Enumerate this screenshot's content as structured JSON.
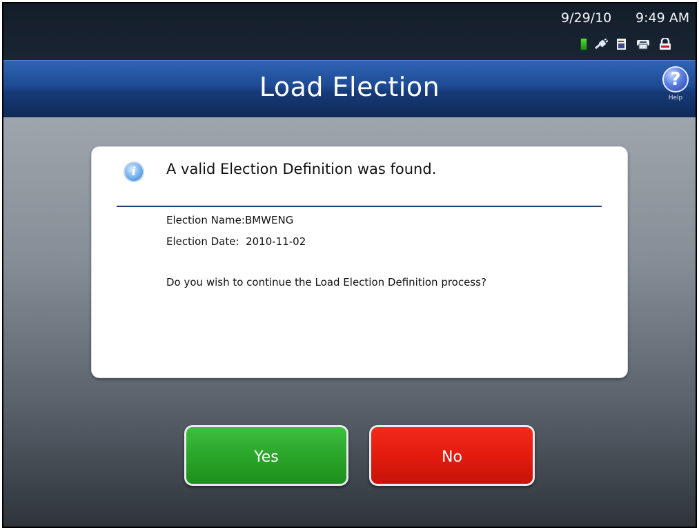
{
  "status_bar": {
    "date": "9/29/10",
    "time": "9:49 AM",
    "icons": [
      "battery-icon",
      "power-plug-icon",
      "memory-card-icon",
      "printer-icon",
      "lock-icon"
    ]
  },
  "header": {
    "title": "Load Election",
    "help_label": "Help",
    "help_glyph": "?"
  },
  "dialog": {
    "heading": "A valid Election Definition was found.",
    "election_name_label": "Election Name:",
    "election_name_value": "BMWENG",
    "election_date_label": "Election Date:",
    "election_date_value": "2010-11-02",
    "question": "Do you wish to continue the Load Election Definition process?"
  },
  "buttons": {
    "yes_label": "Yes",
    "no_label": "No"
  },
  "colors": {
    "title_bar": "#1d4a93",
    "yes_button": "#2aa62a",
    "no_button": "#e21c0e",
    "divider": "#1f3c78"
  }
}
